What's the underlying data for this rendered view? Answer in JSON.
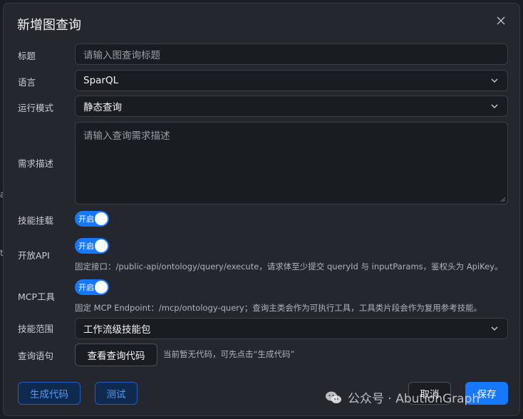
{
  "background": {
    "frag_a": "ati",
    "frag_b": "ty"
  },
  "dialog": {
    "title": "新增图查询",
    "fields": {
      "title_label": "标题",
      "title_placeholder": "请输入图查询标题",
      "language_label": "语言",
      "language_value": "SparQL",
      "mode_label": "运行模式",
      "mode_value": "静态查询",
      "desc_label": "需求描述",
      "desc_placeholder": "请输入查询需求描述",
      "skill_mount_label": "技能挂载",
      "skill_mount_toggle": "开启",
      "open_api_label": "开放API",
      "open_api_toggle": "开启",
      "open_api_hint": "固定接口：/public-api/ontology/query/execute，请求体至少提交 queryId 与 inputParams，鉴权头为 ApiKey。",
      "mcp_label": "MCP工具",
      "mcp_toggle": "开启",
      "mcp_hint": "固定 MCP Endpoint：/mcp/ontology-query；查询主类会作为可执行工具，工具类片段会作为复用参考技能。",
      "skill_scope_label": "技能范围",
      "skill_scope_value": "工作流级技能包",
      "query_stmt_label": "查询语句",
      "view_code_button": "查看查询代码",
      "code_note": "当前暂无代码，可先点击“生成代码”"
    },
    "footer": {
      "generate_button": "生成代码",
      "test_button": "测试",
      "cancel_button": "取消",
      "save_button": "保存"
    }
  },
  "watermark": {
    "text": "公众号 · AbutionGraph"
  },
  "colors": {
    "accent": "#1677ff",
    "dialog_bg": "#24272d",
    "field_bg": "#191c20"
  }
}
